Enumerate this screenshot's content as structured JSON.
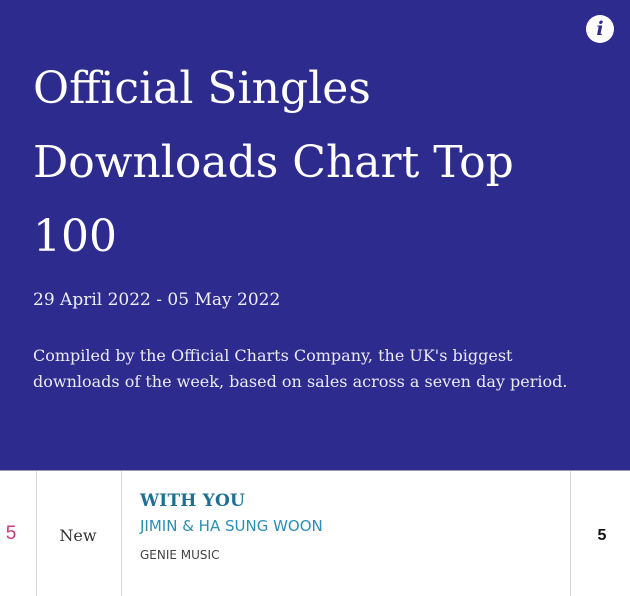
{
  "header": {
    "title": "Official Singles Downloads Chart Top 100",
    "date_range": "29 April 2022 - 05 May 2022",
    "description": "Compiled by the Official Charts Company, the UK's biggest downloads of the week, based on sales across a seven day period.",
    "info_icon": "info-icon",
    "info_glyph": "i"
  },
  "colors": {
    "hero_background": "#2e2b8e",
    "position_text": "#c93a7a",
    "title_text": "#1f6f92",
    "artist_text": "#2b8fb3"
  },
  "chart_row": {
    "position": "5",
    "last_week": "New",
    "title": "WITH YOU",
    "artist": "JIMIN & HA SUNG WOON",
    "label": "GENIE MUSIC",
    "peak": "5"
  }
}
